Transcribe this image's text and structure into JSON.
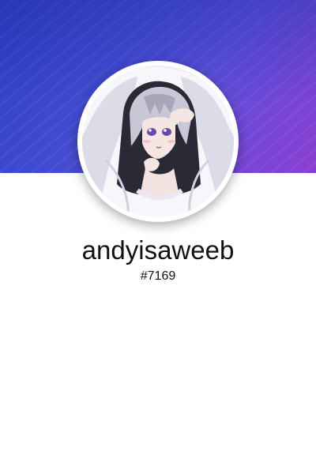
{
  "profile": {
    "username": "andyisaweeb",
    "discriminator": "#7169",
    "avatar_description": "avatar-image"
  },
  "theme": {
    "banner_start": "#2d3fc4",
    "banner_end": "#8a3fd2",
    "background": "#ffffff",
    "text": "#111111"
  }
}
